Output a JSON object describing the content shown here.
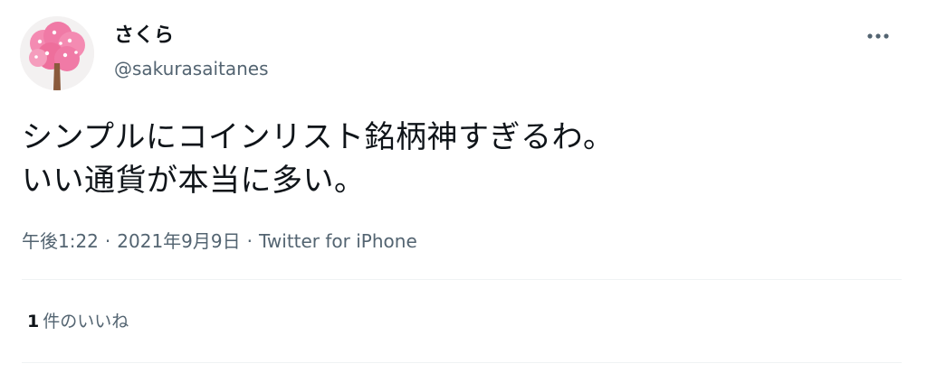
{
  "author": {
    "display_name": "さくら",
    "handle": "@sakurasaitanes",
    "avatar_icon": "cherry-blossom-tree-icon"
  },
  "tweet": {
    "lines": [
      "シンプルにコインリスト銘柄神すぎるわ。",
      "いい通貨が本当に多い。"
    ]
  },
  "meta": {
    "time": "午後1:22",
    "separator": "·",
    "date": "2021年9月9日",
    "source": "Twitter for iPhone"
  },
  "stats": {
    "like_count": "1",
    "like_label": "件のいいね"
  },
  "menu": {
    "more_icon": "more-dots-icon"
  },
  "colors": {
    "text": "#0f1419",
    "secondary_text": "#536471",
    "divider": "#eff3f4",
    "blossom": "#f07aa6",
    "trunk": "#8a5a3c"
  }
}
